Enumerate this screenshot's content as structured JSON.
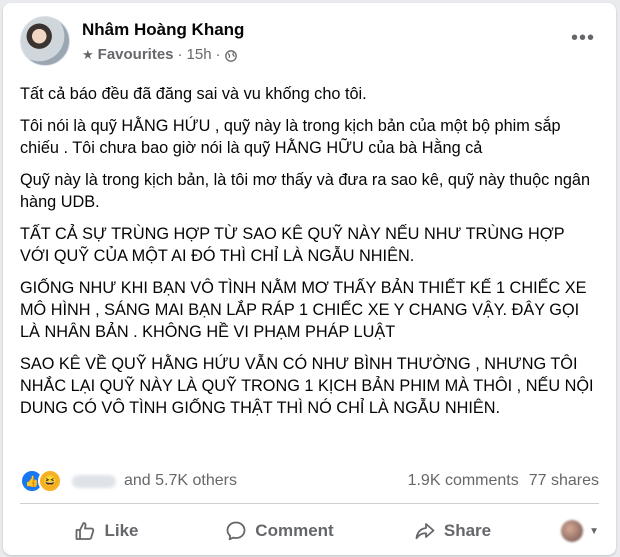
{
  "post": {
    "author": "Nhâm Hoàng Khang",
    "audience": "Favourites",
    "separator": "·",
    "time": "15h",
    "more_label": "•••",
    "paragraphs": [
      "Tất cả báo đều đã đăng sai và vu khống cho tôi.",
      "Tôi nói là quỹ HẰNG HỨU , quỹ này là trong kịch bản của một bộ phim sắp chiếu . Tôi chưa bao giờ nói là quỹ HẰNG HỮU của bà Hằng cả",
      "Quỹ này là trong kịch bản, là tôi mơ thấy và đưa ra sao kê, quỹ này thuộc ngân hàng UDB.",
      "TẤT CẢ SỰ TRÙNG HỢP TỪ SAO KÊ QUỸ NÀY NẾU NHƯ TRÙNG HỢP VỚI QUỸ CỦA MỘT AI ĐÓ THÌ CHỈ LÀ NGẪU NHIÊN.",
      "GIỐNG NHƯ KHI BẠN VÔ TÌNH NẰM MƠ THẤY BẢN THIẾT KẾ 1 CHIẾC XE MÔ HÌNH , SÁNG MAI BẠN LẮP RÁP 1 CHIẾC XE Y CHANG VẬY. ĐÂY GỌI LÀ NHÂN BẢN . KHÔNG HỀ VI PHẠM PHÁP LUẬT",
      "SAO KÊ VỀ QUỸ HẰNG HỨU VẪN CÓ NHƯ BÌNH THƯỜNG , NHƯNG TÔI NHẮC LẠI QUỸ NÀY LÀ QUỸ TRONG 1 KỊCH BẢN PHIM MÀ THÔI , NẾU NỘI DUNG CÓ VÔ TÌNH GIỐNG THẬT THÌ NÓ CHỈ LÀ NGẪU NHIÊN."
    ]
  },
  "stats": {
    "reactions_others": "and 5.7K others",
    "comments": "1.9K comments",
    "shares": "77 shares",
    "like_emoji": "👍",
    "haha_emoji": "😆"
  },
  "actions": {
    "like": "Like",
    "comment": "Comment",
    "share": "Share"
  },
  "colors": {
    "brand_blue": "#1877f2",
    "secondary_text": "#65676b",
    "primary_text": "#050505"
  }
}
